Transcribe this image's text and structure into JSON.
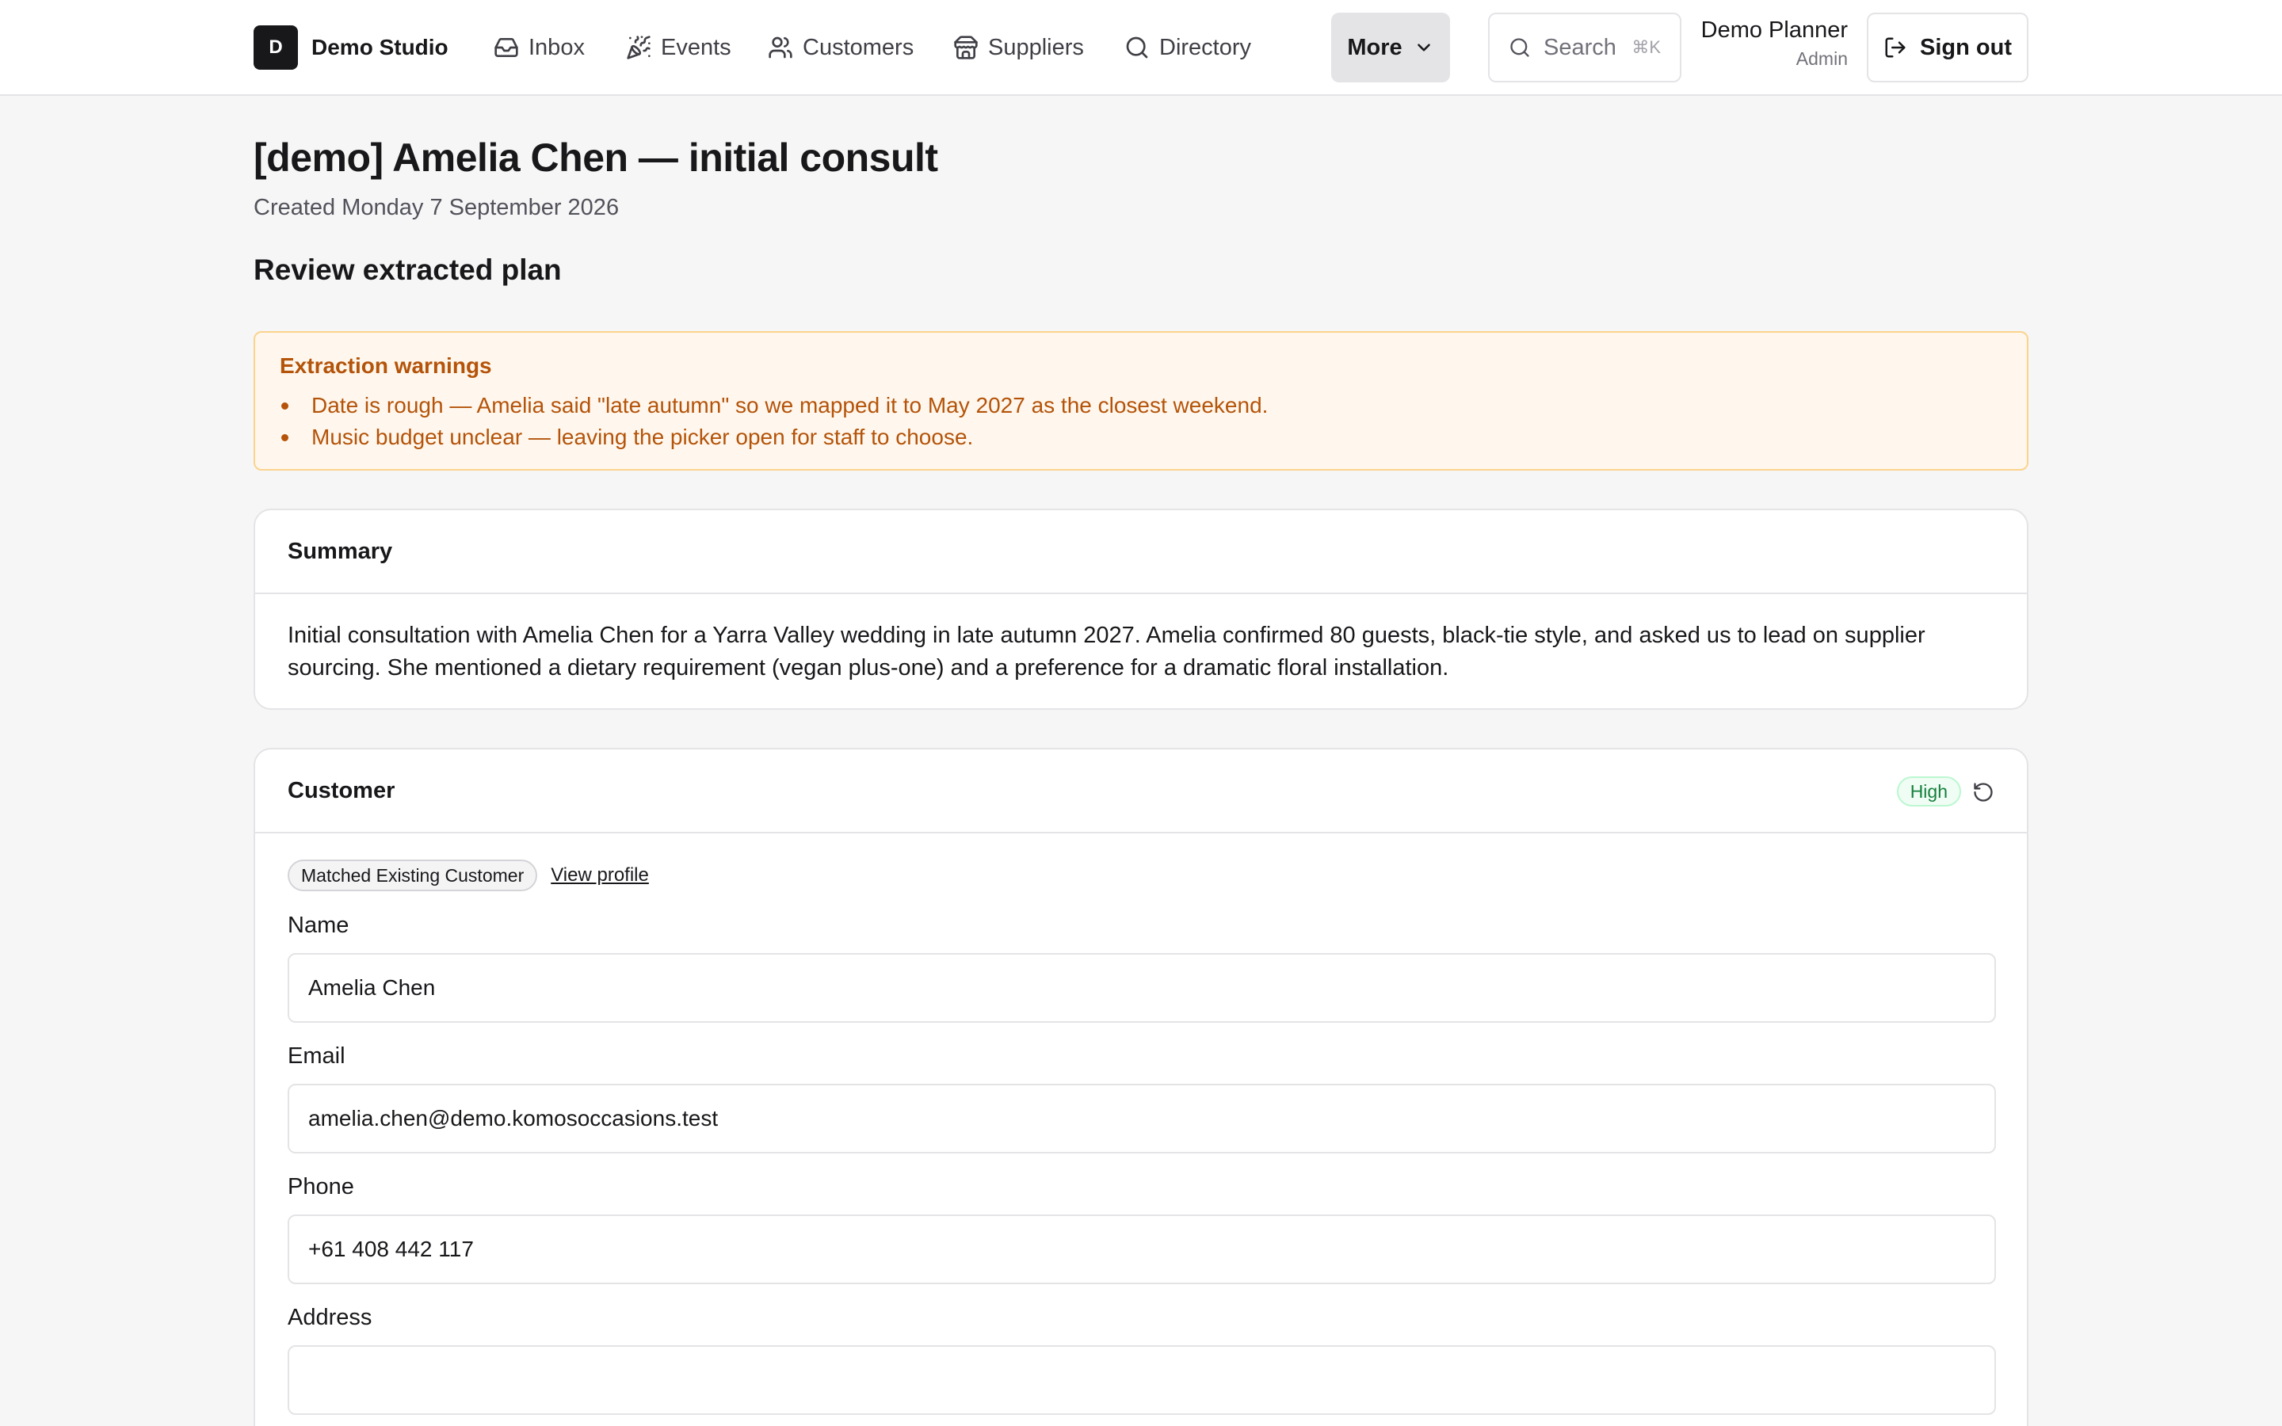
{
  "header": {
    "brand_initial": "D",
    "brand_name": "Demo Studio",
    "nav": [
      {
        "label": "Inbox",
        "icon": "inbox-icon"
      },
      {
        "label": "Events",
        "icon": "party-popper-icon"
      },
      {
        "label": "Customers",
        "icon": "users-icon"
      },
      {
        "label": "Suppliers",
        "icon": "store-icon"
      },
      {
        "label": "Directory",
        "icon": "search-icon"
      }
    ],
    "more_label": "More",
    "search_label": "Search",
    "search_shortcut": "⌘K",
    "user_name": "Demo Planner",
    "user_role": "Admin",
    "signout_label": "Sign out"
  },
  "page": {
    "title": "[demo] Amelia Chen — initial consult",
    "created": "Created Monday 7 September 2026",
    "section_title": "Review extracted plan"
  },
  "warnings": {
    "title": "Extraction warnings",
    "items": [
      "Date is rough — Amelia said \"late autumn\" so we mapped it to May 2027 as the closest weekend.",
      "Music budget unclear — leaving the picker open for staff to choose."
    ]
  },
  "summary": {
    "title": "Summary",
    "text": "Initial consultation with Amelia Chen for a Yarra Valley wedding in late autumn 2027. Amelia confirmed 80 guests, black-tie style, and asked us to lead on supplier sourcing. She mentioned a dietary requirement (vegan plus-one) and a preference for a dramatic floral installation."
  },
  "customer": {
    "title": "Customer",
    "confidence": "High",
    "match_badge": "Matched Existing Customer",
    "view_profile": "View profile",
    "fields": {
      "name": {
        "label": "Name",
        "value": "Amelia Chen"
      },
      "email": {
        "label": "Email",
        "value": "amelia.chen@demo.komosoccasions.test"
      },
      "phone": {
        "label": "Phone",
        "value": "+61 408 442 117"
      },
      "address": {
        "label": "Address",
        "value": ""
      }
    }
  },
  "colors": {
    "warning_text": "#b45309",
    "warning_bg": "#fff7ed",
    "high_badge": "#15803d"
  }
}
